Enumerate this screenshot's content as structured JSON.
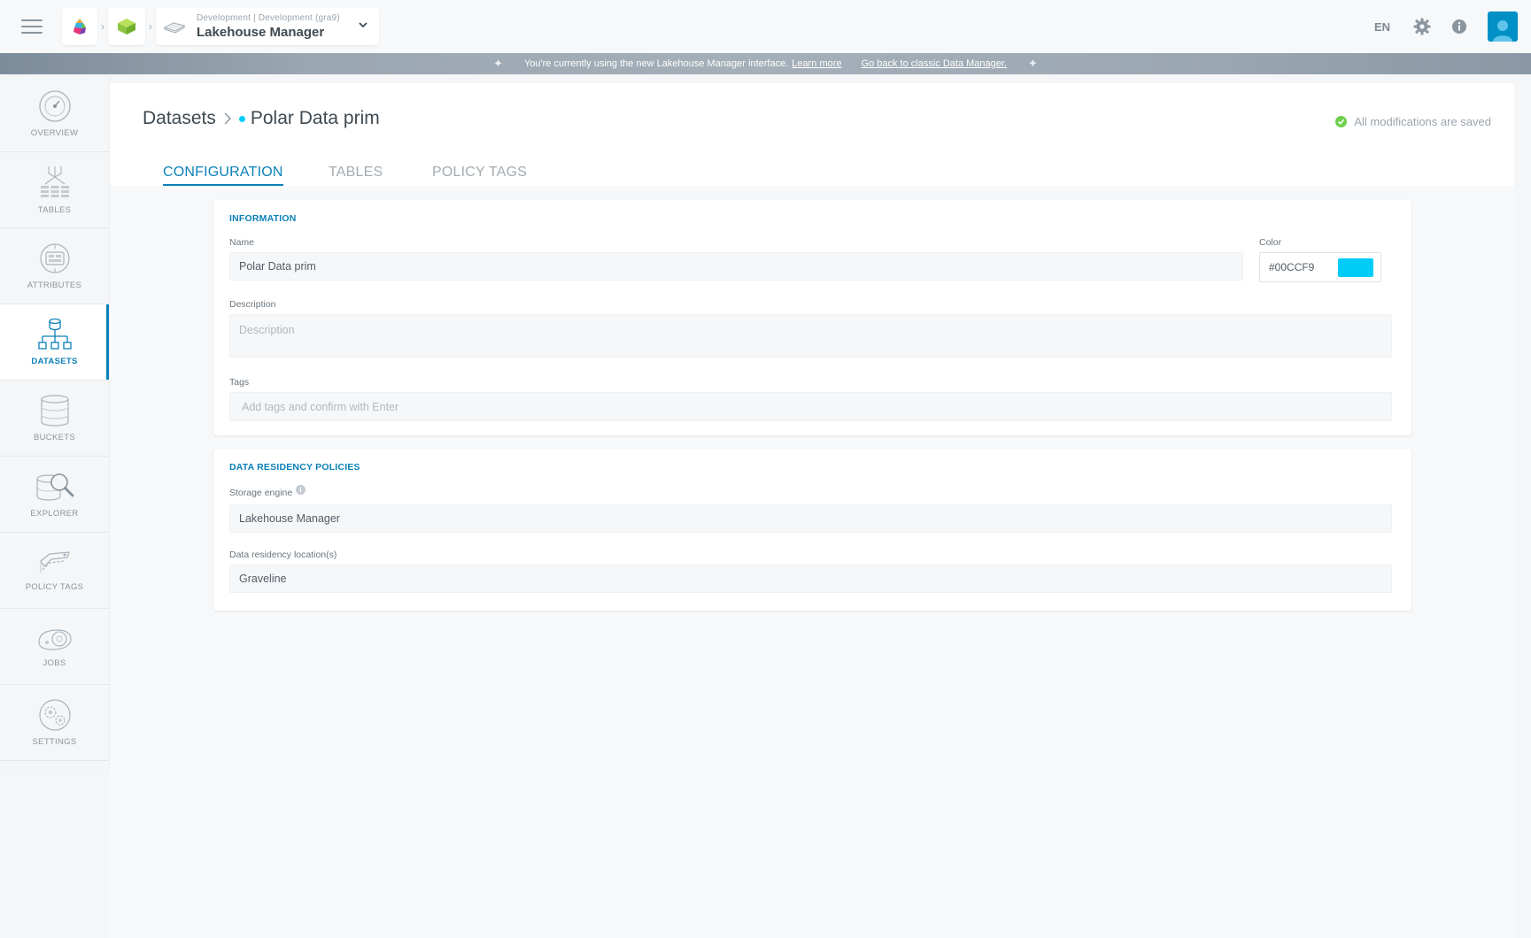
{
  "topbar": {
    "breadcrumb_subtitle": "Development | Development (gra9)",
    "breadcrumb_title": "Lakehouse Manager",
    "language": "EN"
  },
  "banner": {
    "message": "You're currently using the new Lakehouse Manager interface.",
    "learn_more": "Learn more",
    "classic_link": "Go back to classic Data Manager."
  },
  "sidebar": {
    "items": [
      {
        "label": "OVERVIEW",
        "icon": "overview-icon",
        "active": false
      },
      {
        "label": "TABLES",
        "icon": "tables-icon",
        "active": false
      },
      {
        "label": "ATTRIBUTES",
        "icon": "attributes-icon",
        "active": false
      },
      {
        "label": "DATASETS",
        "icon": "datasets-icon",
        "active": true
      },
      {
        "label": "BUCKETS",
        "icon": "buckets-icon",
        "active": false
      },
      {
        "label": "EXPLORER",
        "icon": "explorer-icon",
        "active": false
      },
      {
        "label": "POLICY TAGS",
        "icon": "policy-tags-icon",
        "active": false
      },
      {
        "label": "JOBS",
        "icon": "jobs-icon",
        "active": false
      },
      {
        "label": "SETTINGS",
        "icon": "settings-icon",
        "active": false
      }
    ]
  },
  "page": {
    "breadcrumb_root": "Datasets",
    "dataset_name": "Polar Data prim",
    "save_status": "All modifications are saved"
  },
  "tabs": [
    {
      "label": "CONFIGURATION",
      "active": true
    },
    {
      "label": "TABLES",
      "active": false
    },
    {
      "label": "POLICY TAGS",
      "active": false
    }
  ],
  "information": {
    "title": "INFORMATION",
    "name_label": "Name",
    "name_value": "Polar Data prim",
    "color_label": "Color",
    "color_value": "#00CCF9",
    "description_label": "Description",
    "description_placeholder": "Description",
    "tags_label": "Tags",
    "tags_placeholder": "Add tags and confirm with Enter"
  },
  "residency": {
    "title": "DATA RESIDENCY POLICIES",
    "storage_label": "Storage engine",
    "storage_value": "Lakehouse Manager",
    "location_label": "Data residency location(s)",
    "location_value": "Graveline"
  },
  "colors": {
    "accent": "#0c81b8",
    "dataset": "#00ccf9",
    "saved": "#6fcf4a"
  }
}
